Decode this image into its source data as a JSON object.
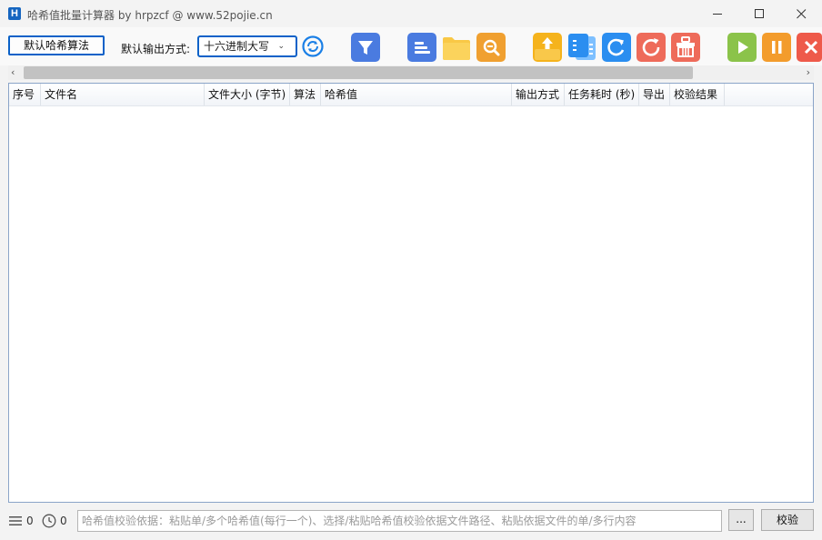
{
  "window": {
    "app_icon_letter": "H",
    "title": "哈希值批量计算器 by hrpzcf @ www.52pojie.cn"
  },
  "toolbar": {
    "algo_button_label": "默认哈希算法",
    "output_label": "默认输出方式:",
    "output_select_value": "十六进制大写",
    "icons": [
      "refresh-ring-icon",
      "filter-icon",
      "align-list-icon",
      "folder-icon",
      "search-zoom-icon",
      "upload-tray-icon",
      "copy-list-icon",
      "rotate-right-icon",
      "reload-icon",
      "basket-icon",
      "play-icon",
      "pause-icon",
      "stop-icon"
    ],
    "colors": {
      "accent": "#0b61c8",
      "filter": "#4a7be0",
      "align": "#4a7be0",
      "folder": "#f9c846",
      "search": "#f0a030",
      "upload": "#f5b31c",
      "copy": "#2b8ef0",
      "rotate": "#2b8ef0",
      "reload": "#ee6b5a",
      "basket": "#ee6b5a",
      "play": "#8bc34a",
      "pause": "#f39c2c",
      "stop": "#ee5a4a"
    }
  },
  "table": {
    "columns": [
      "序号",
      "文件名",
      "文件大小 (字节)",
      "算法",
      "哈希值",
      "输出方式",
      "任务耗时 (秒)",
      "导出",
      "校验结果"
    ],
    "rows": []
  },
  "status": {
    "list_count": "0",
    "time_count": "0",
    "verify_placeholder": "哈希值校验依据：粘贴单/多个哈希值(每行一个)、选择/粘贴哈希值校验依据文件路径、粘贴依据文件的单/多行内容",
    "browse_label": "...",
    "verify_label": "校验"
  }
}
